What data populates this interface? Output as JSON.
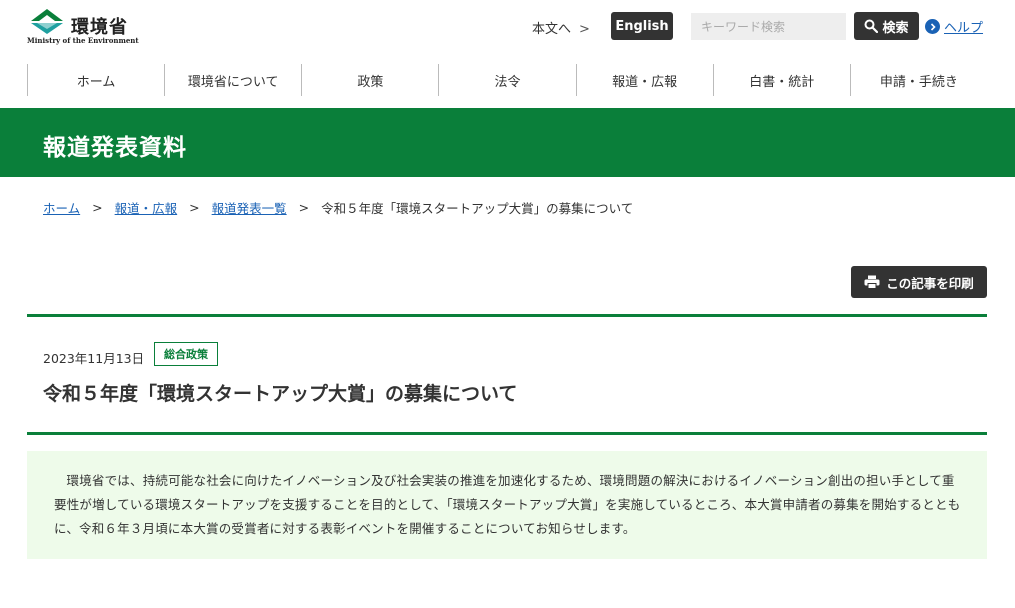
{
  "header": {
    "logo_ja": "環境省",
    "logo_en": "Ministry of the Environment",
    "skip_label": "本文へ",
    "skip_chevron": ">",
    "english_label": "English",
    "search_placeholder": "キーワード検索",
    "search_label": "検索",
    "help_label": "ヘルプ",
    "brand_color": "#0a7f3a"
  },
  "nav": {
    "items": [
      "ホーム",
      "環境省について",
      "政策",
      "法令",
      "報道・広報",
      "白書・統計",
      "申請・手続き"
    ]
  },
  "band": {
    "title": "報道発表資料"
  },
  "breadcrumb": {
    "items": [
      "ホーム",
      "報道・広報",
      "報道発表一覧"
    ],
    "separator": ">",
    "current": "令和５年度「環境スタートアップ大賞」の募集について"
  },
  "print": {
    "label": "この記事を印刷",
    "icon": "printer-icon"
  },
  "article": {
    "date": "2023年11月13日",
    "tag": "総合政策",
    "title": "令和５年度「環境スタートアップ大賞」の募集について",
    "summary": "環境省では、持続可能な社会に向けたイノベーション及び社会実装の推進を加速化するため、環境問題の解決におけるイノベーション創出の担い手として重要性が増している環境スタートアップを支援することを目的として、「環境スタートアップ大賞」を実施しているところ、本大賞申請者の募集を開始するとともに、令和６年３月頃に本大賞の受賞者に対する表彰イベントを開催することについてお知らせします。"
  }
}
